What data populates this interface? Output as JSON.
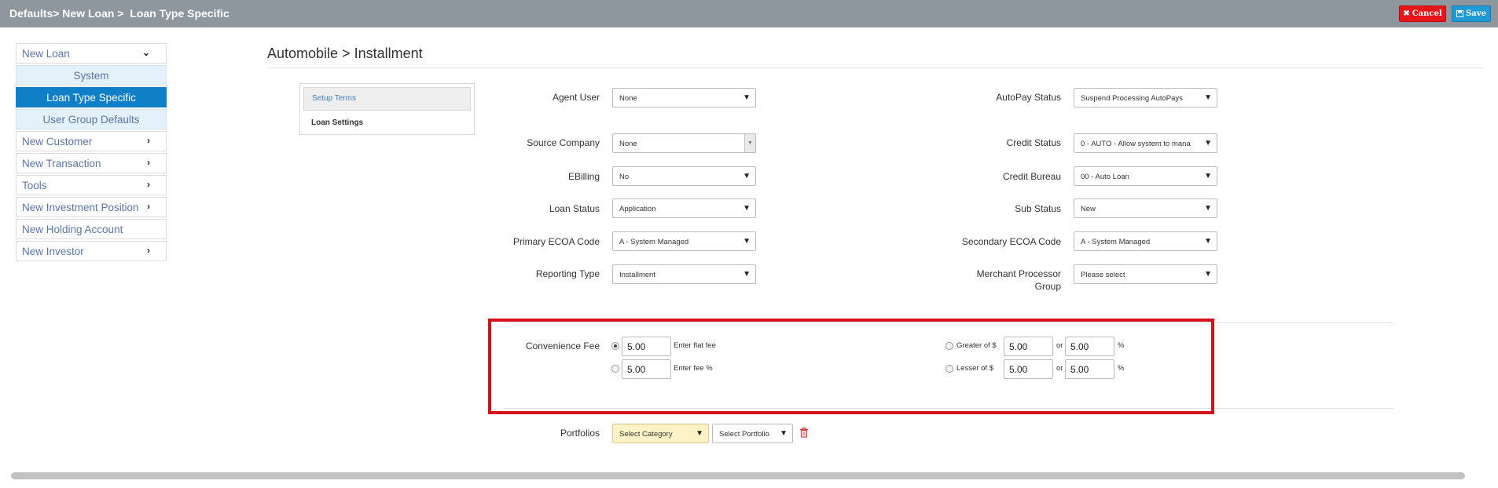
{
  "header": {
    "breadcrumb": "Defaults> New Loan >  Loan Type Specific",
    "cancel_label": "Cancel",
    "save_label": "Save"
  },
  "sidebar": {
    "items": [
      {
        "label": "New Loan",
        "expanded": true
      },
      {
        "label": "System"
      },
      {
        "label": "Loan Type Specific",
        "active": true
      },
      {
        "label": "User Group Defaults"
      },
      {
        "label": "New Customer"
      },
      {
        "label": "New Transaction"
      },
      {
        "label": "Tools"
      },
      {
        "label": "New Investment Position"
      },
      {
        "label": "New Holding Account"
      },
      {
        "label": "New Investor"
      }
    ]
  },
  "page": {
    "title": "Automobile > Installment",
    "tabs": [
      "Setup Terms",
      "Loan Settings"
    ]
  },
  "form": {
    "agent_user": {
      "label": "Agent User",
      "value": "None"
    },
    "source_company": {
      "label": "Source Company",
      "value": "None"
    },
    "ebilling": {
      "label": "EBilling",
      "value": "No"
    },
    "loan_status": {
      "label": "Loan Status",
      "value": "Application"
    },
    "primary_ecoa": {
      "label": "Primary ECOA Code",
      "value": "A - System Managed"
    },
    "reporting_type": {
      "label": "Reporting Type",
      "value": "Installment"
    },
    "autopay_status": {
      "label": "AutoPay Status",
      "value": "Suspend Processing AutoPays"
    },
    "credit_status": {
      "label": "Credit Status",
      "value": "0 - AUTO - Allow system to mana"
    },
    "credit_bureau": {
      "label": "Credit Bureau",
      "value": "00 - Auto Loan"
    },
    "sub_status": {
      "label": "Sub Status",
      "value": "New"
    },
    "secondary_ecoa": {
      "label": "Secondary ECOA Code",
      "value": "A - System Managed"
    },
    "merchant_processor": {
      "label_line1": "Merchant Processor",
      "label_line2": "Group",
      "value": "Please select"
    }
  },
  "convenience_fee": {
    "label": "Convenience Fee",
    "flat_value": "5.00",
    "flat_text": "Enter flat fee",
    "pct_value": "5.00",
    "pct_text": "Enter fee %",
    "greater_label": "Greater of $",
    "greater_value1": "5.00",
    "greater_value2": "5.00",
    "lesser_label": "Lesser of $",
    "lesser_value1": "5.00",
    "lesser_value2": "5.00",
    "or_text": "or",
    "percent_text": "%"
  },
  "portfolios": {
    "label": "Portfolios",
    "category_placeholder": "Select Category",
    "portfolio_placeholder": "Select Portfolio"
  },
  "colors": {
    "topbar": "#8e979e",
    "active_nav": "#0f7fc7",
    "cancel": "#e8151b",
    "save": "#1e9ad6",
    "highlight": "#d7101c"
  }
}
